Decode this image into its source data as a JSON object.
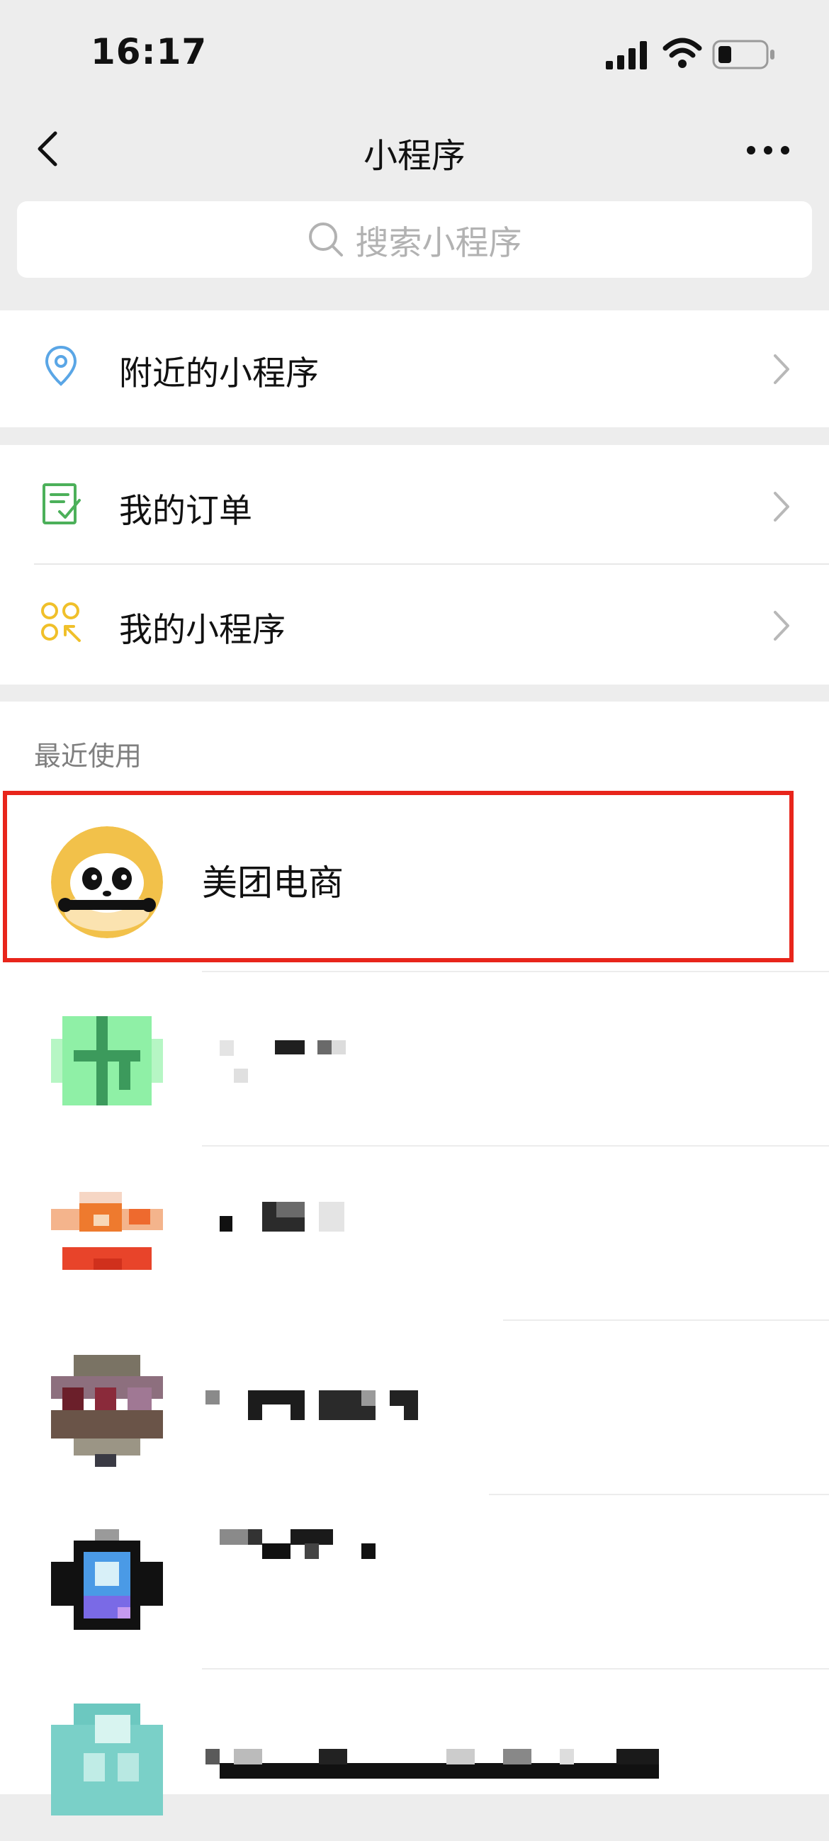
{
  "status_bar": {
    "time": "16:17"
  },
  "nav": {
    "title": "小程序"
  },
  "search": {
    "placeholder": "搜索小程序"
  },
  "menu": {
    "nearby": "附近的小程序",
    "orders": "我的订单",
    "my_programs": "我的小程序"
  },
  "recent": {
    "header": "最近使用",
    "items": [
      {
        "name": "美团电商",
        "highlighted": true
      },
      {
        "name": "",
        "obscured": true
      },
      {
        "name": "",
        "obscured": true
      },
      {
        "name": "",
        "obscured": true
      },
      {
        "name": "",
        "obscured": true
      },
      {
        "name": "",
        "obscured": true
      }
    ]
  },
  "colors": {
    "accent_highlight": "#e8251b",
    "location_icon": "#5aa6e6",
    "order_icon": "#4cb05a",
    "program_icon": "#f0c02a",
    "panda_bg": "#f2c14a"
  }
}
